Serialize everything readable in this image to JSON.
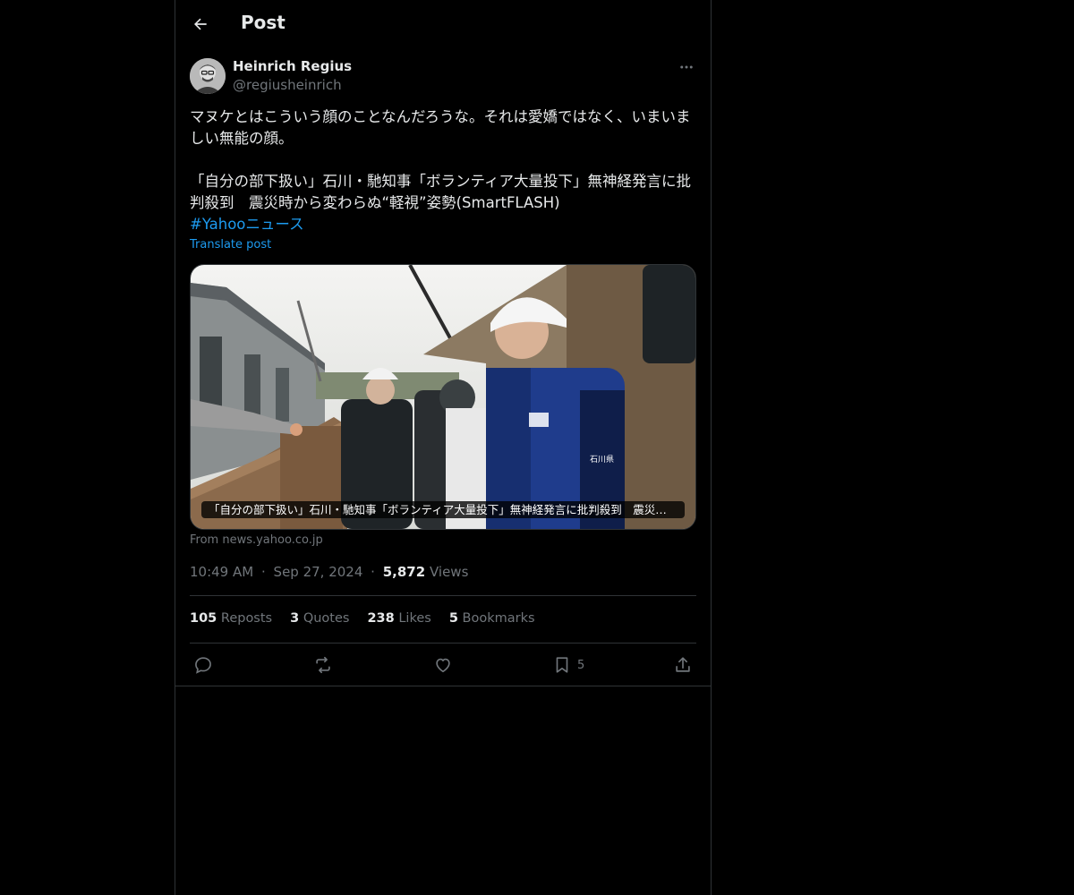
{
  "header": {
    "title": "Post",
    "back_icon": "arrow-left-icon"
  },
  "author": {
    "display_name": "Heinrich Regius",
    "handle": "@regiusheinrich",
    "more_icon": "more-horizontal-icon"
  },
  "post": {
    "paragraphs": [
      "マヌケとはこういう顔のことなんだろうな。それは愛嬌ではなく、いまいましい無能の顔。",
      "「自分の部下扱い」石川・馳知事「ボランティア大量投下」無神経発言に批判殺到　震災時から変わらぬ“軽視”姿勢(SmartFLASH)"
    ],
    "hashtag": "#Yahooニュース",
    "translate_label": "Translate post"
  },
  "card": {
    "caption": "「自分の部下扱い」石川・馳知事「ボランティア大量投下」無神経発言に批判殺到　震災時から変わらぬ“軽視”姿勢",
    "source": "From news.yahoo.co.jp",
    "jacket_label": "石川県"
  },
  "meta": {
    "time": "10:49 AM",
    "separator": "·",
    "date": "Sep 27, 2024",
    "views_count": "5,872",
    "views_label": "Views"
  },
  "stats": [
    {
      "count": "105",
      "label": "Reposts"
    },
    {
      "count": "3",
      "label": "Quotes"
    },
    {
      "count": "238",
      "label": "Likes"
    },
    {
      "count": "5",
      "label": "Bookmarks"
    }
  ],
  "actions": {
    "reply_icon": "reply-icon",
    "repost_icon": "repost-icon",
    "like_icon": "heart-icon",
    "bookmark_icon": "bookmark-icon",
    "bookmark_count": "5",
    "share_icon": "share-icon"
  },
  "colors": {
    "background": "#000000",
    "text": "#e7e9ea",
    "secondary": "#71767b",
    "accent": "#1d9bf0",
    "border": "#2f3336"
  }
}
